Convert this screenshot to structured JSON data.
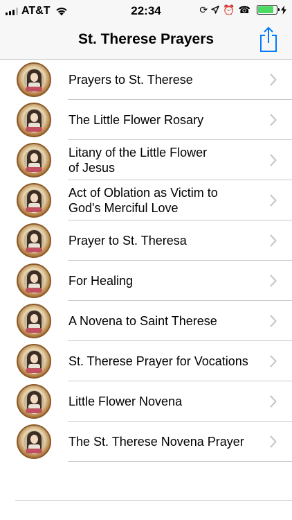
{
  "status_bar": {
    "carrier": "AT&T",
    "time": "22:34",
    "battery_level": 0.85,
    "battery_color": "#4cd964",
    "icons": [
      "signal-icon",
      "wifi-icon",
      "lock-rotation-icon",
      "location-icon",
      "alarm-icon",
      "tty-icon",
      "battery-icon",
      "charging-icon"
    ]
  },
  "nav": {
    "title": "St. Therese Prayers",
    "share_icon": "share-icon",
    "accent": "#007aff"
  },
  "prayers": [
    {
      "label": "Prayers to St. Therese"
    },
    {
      "label": "The Little Flower Rosary"
    },
    {
      "label": "Litany of the Little Flower\nof Jesus"
    },
    {
      "label": "Act of Oblation as Victim to\nGod's Merciful Love"
    },
    {
      "label": "Prayer to St. Theresa"
    },
    {
      "label": "For Healing"
    },
    {
      "label": "A Novena to Saint Therese"
    },
    {
      "label": "St. Therese Prayer for Vocations"
    },
    {
      "label": "Little Flower Novena"
    },
    {
      "label": "The St. Therese Novena Prayer"
    }
  ],
  "row_icons": {
    "thumbnail": "saint-therese-portrait-icon",
    "disclosure": "chevron-right-icon"
  }
}
